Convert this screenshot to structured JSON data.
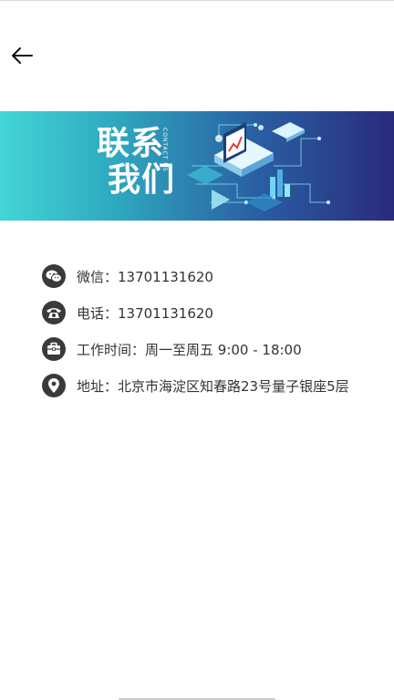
{
  "header": {
    "back_icon": "arrow-left-icon"
  },
  "banner": {
    "title_line1": "联系",
    "title_line2": "我们",
    "subtitle": "CONTACT US",
    "colors": {
      "start": "#43d6d6",
      "end": "#2a2a7d"
    }
  },
  "contact": {
    "items": [
      {
        "icon": "wechat-icon",
        "label": "微信：13701131620"
      },
      {
        "icon": "phone-icon",
        "label": "电话：13701131620"
      },
      {
        "icon": "briefcase-icon",
        "label": "工作时间：周一至周五 9:00 - 18:00"
      },
      {
        "icon": "location-pin-icon",
        "label": "地址：北京市海淀区知春路23号量子银座5层"
      }
    ]
  }
}
